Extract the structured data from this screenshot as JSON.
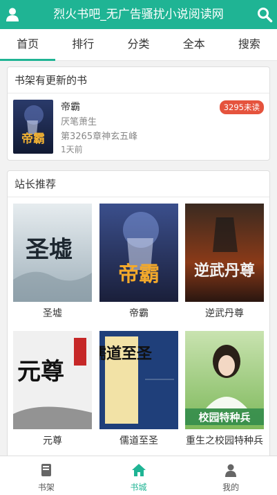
{
  "header": {
    "title": "烈火书吧_无广告骚扰小说阅读网",
    "icons": {
      "left": "user-icon",
      "right": "search-icon"
    },
    "color": "#1fb494"
  },
  "nav": {
    "tabs": [
      {
        "label": "首页",
        "active": true
      },
      {
        "label": "排行"
      },
      {
        "label": "分类"
      },
      {
        "label": "全本"
      },
      {
        "label": "搜索"
      }
    ]
  },
  "updates": {
    "title": "书架有更新的书",
    "item": {
      "name": "帝霸",
      "author": "厌笔萧生",
      "chapter": "第3265章神玄五峰",
      "time": "1天前",
      "badge": "3295未读",
      "cover_text": "帝霸"
    }
  },
  "recommend": {
    "title": "站长推荐",
    "books": [
      {
        "name": "圣墟",
        "cover_text": "圣墟"
      },
      {
        "name": "帝霸",
        "cover_text": "帝霸"
      },
      {
        "name": "逆武丹尊",
        "cover_text": "逆武丹尊"
      },
      {
        "name": "元尊",
        "cover_text": "元尊"
      },
      {
        "name": "儒道至圣",
        "cover_text": "儒道至圣"
      },
      {
        "name": "重生之校园特种兵",
        "cover_text": "校园特种兵"
      }
    ]
  },
  "footer": {
    "items": [
      {
        "label": "书架",
        "icon": "book-icon"
      },
      {
        "label": "书城",
        "icon": "home-icon",
        "active": true
      },
      {
        "label": "我的",
        "icon": "user-icon"
      }
    ]
  }
}
